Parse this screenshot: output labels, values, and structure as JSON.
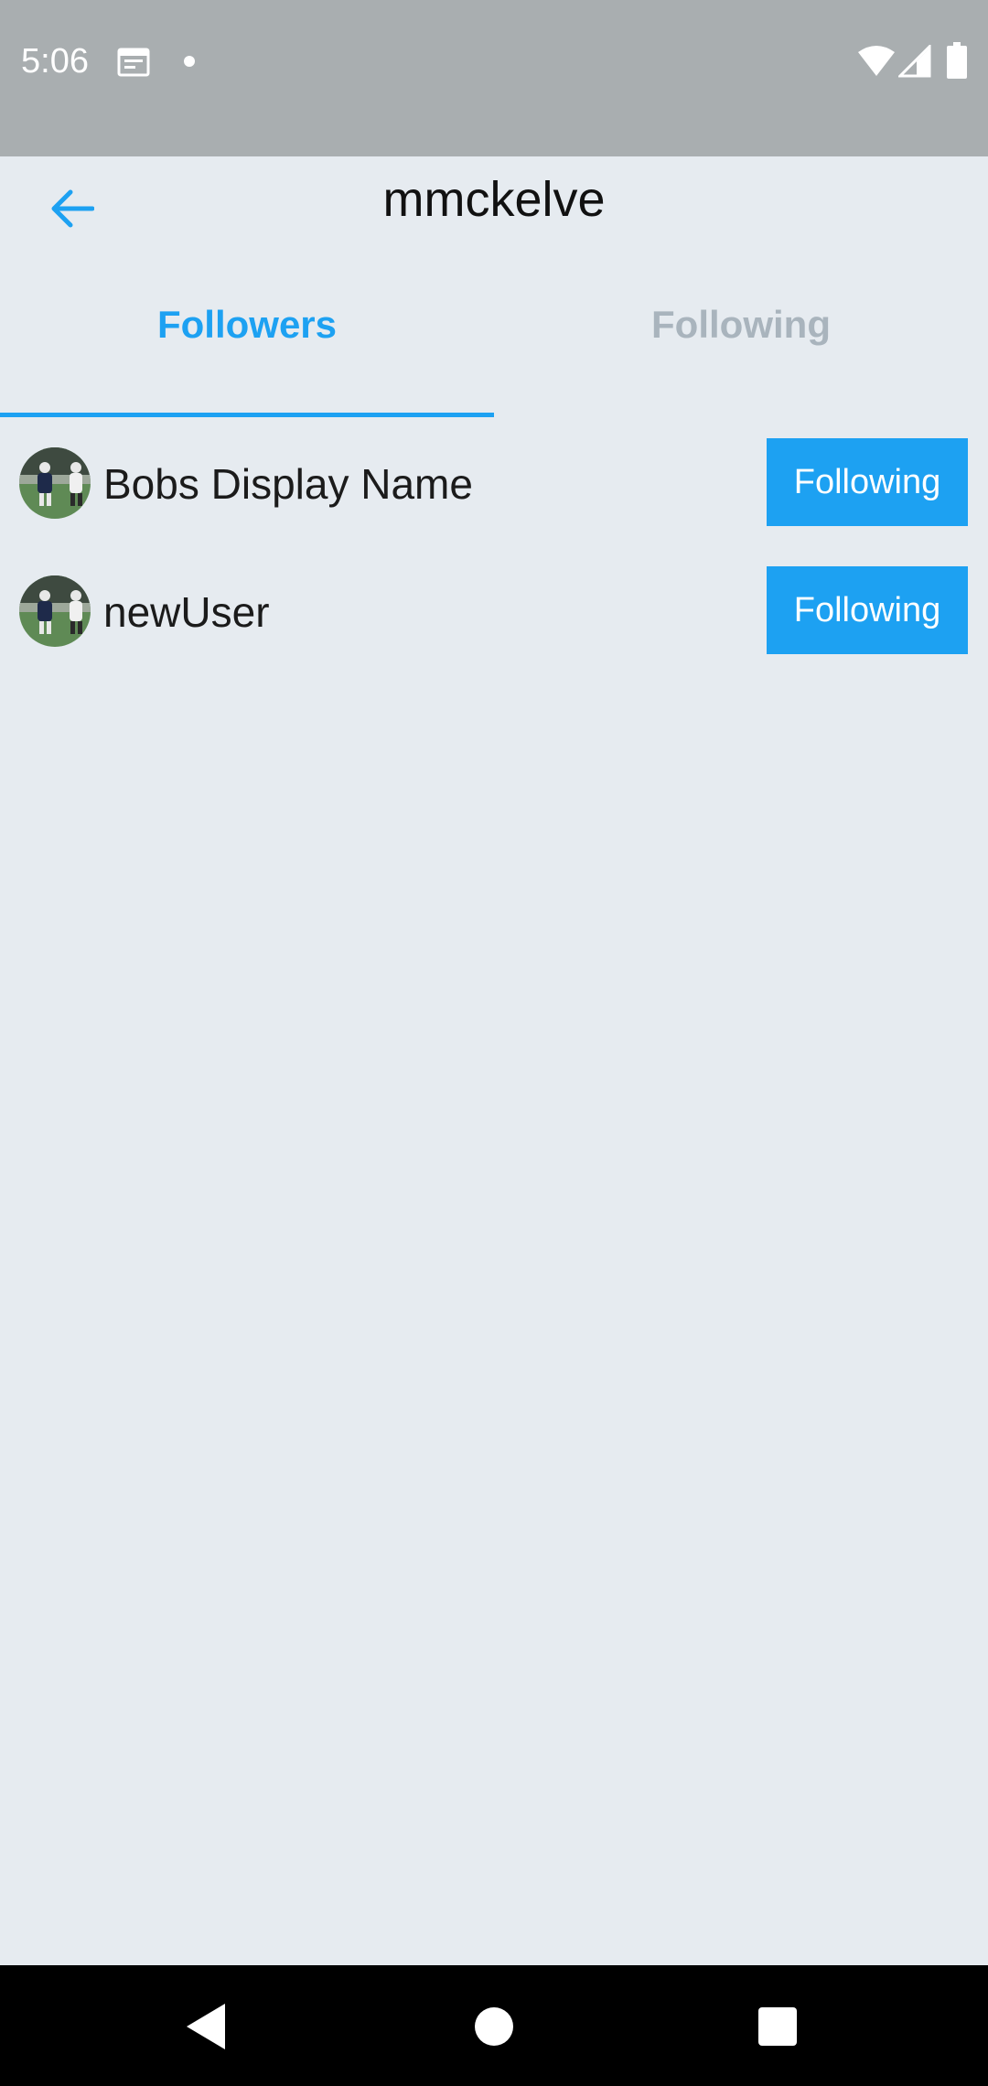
{
  "status_bar": {
    "time": "5:06",
    "icons": [
      "calendar-icon",
      "dot-icon",
      "wifi-icon",
      "signal-icon",
      "battery-icon"
    ]
  },
  "header": {
    "title": "mmckelve",
    "back_icon": "arrow-left-icon"
  },
  "tabs": [
    {
      "label": "Followers",
      "active": true
    },
    {
      "label": "Following",
      "active": false
    }
  ],
  "followers": [
    {
      "name": "Bobs Display Name",
      "button_label": "Following"
    },
    {
      "name": "newUser",
      "button_label": "Following"
    }
  ],
  "colors": {
    "accent": "#1da1f2",
    "background": "#e6ebf0",
    "inactive_tab": "#a9b4bd",
    "status_bar": "#a9aeb0"
  },
  "nav_bar": {
    "icons": [
      "nav-back-icon",
      "nav-home-icon",
      "nav-recents-icon"
    ]
  }
}
